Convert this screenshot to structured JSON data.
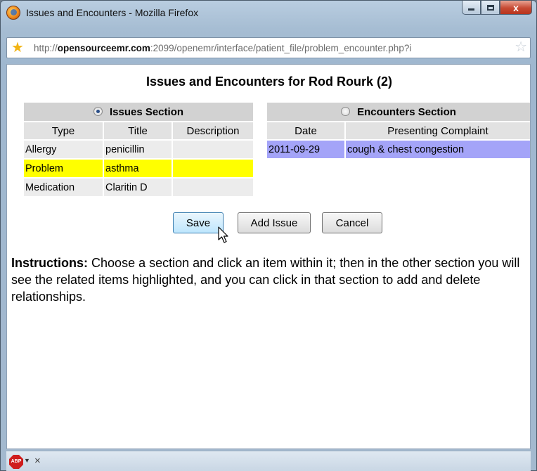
{
  "window": {
    "title": "Issues and Encounters - Mozilla Firefox",
    "close_glyph": "x"
  },
  "address_bar": {
    "url_prefix": "http://",
    "url_host": "opensourceemr.com",
    "url_rest": ":2099/openemr/interface/patient_file/problem_encounter.php?i"
  },
  "page": {
    "title": "Issues and Encounters for Rod Rourk (2)"
  },
  "issues": {
    "section_label": "Issues Section",
    "selected": true,
    "columns": [
      "Type",
      "Title",
      "Description"
    ],
    "rows": [
      {
        "type": "Allergy",
        "title": "penicillin",
        "description": ""
      },
      {
        "type": "Problem",
        "title": "asthma",
        "description": "",
        "highlighted": true
      },
      {
        "type": "Medication",
        "title": "Claritin D",
        "description": ""
      }
    ]
  },
  "encounters": {
    "section_label": "Encounters Section",
    "selected": false,
    "columns": [
      "Date",
      "Presenting Complaint"
    ],
    "rows": [
      {
        "date": "2011-09-29",
        "complaint": "cough & chest congestion",
        "highlighted": true
      }
    ]
  },
  "buttons": {
    "save": "Save",
    "add_issue": "Add Issue",
    "cancel": "Cancel"
  },
  "instructions": {
    "label": "Instructions:",
    "text": "Choose a section and click an item within it; then in the other section you will see the related items highlighted, and you can click in that section to add and delete relationships."
  },
  "statusbar": {
    "abp_label": "ABP",
    "close_glyph": "×"
  },
  "colors": {
    "highlight_issue": "#ffff00",
    "highlight_encounter": "#a4a4f8",
    "section_header": "#d2d2d2"
  },
  "icons": [
    "firefox-icon",
    "star-icon",
    "bookmark-star-icon",
    "adblock-plus-icon",
    "radio-icon",
    "mouse-cursor-icon"
  ]
}
